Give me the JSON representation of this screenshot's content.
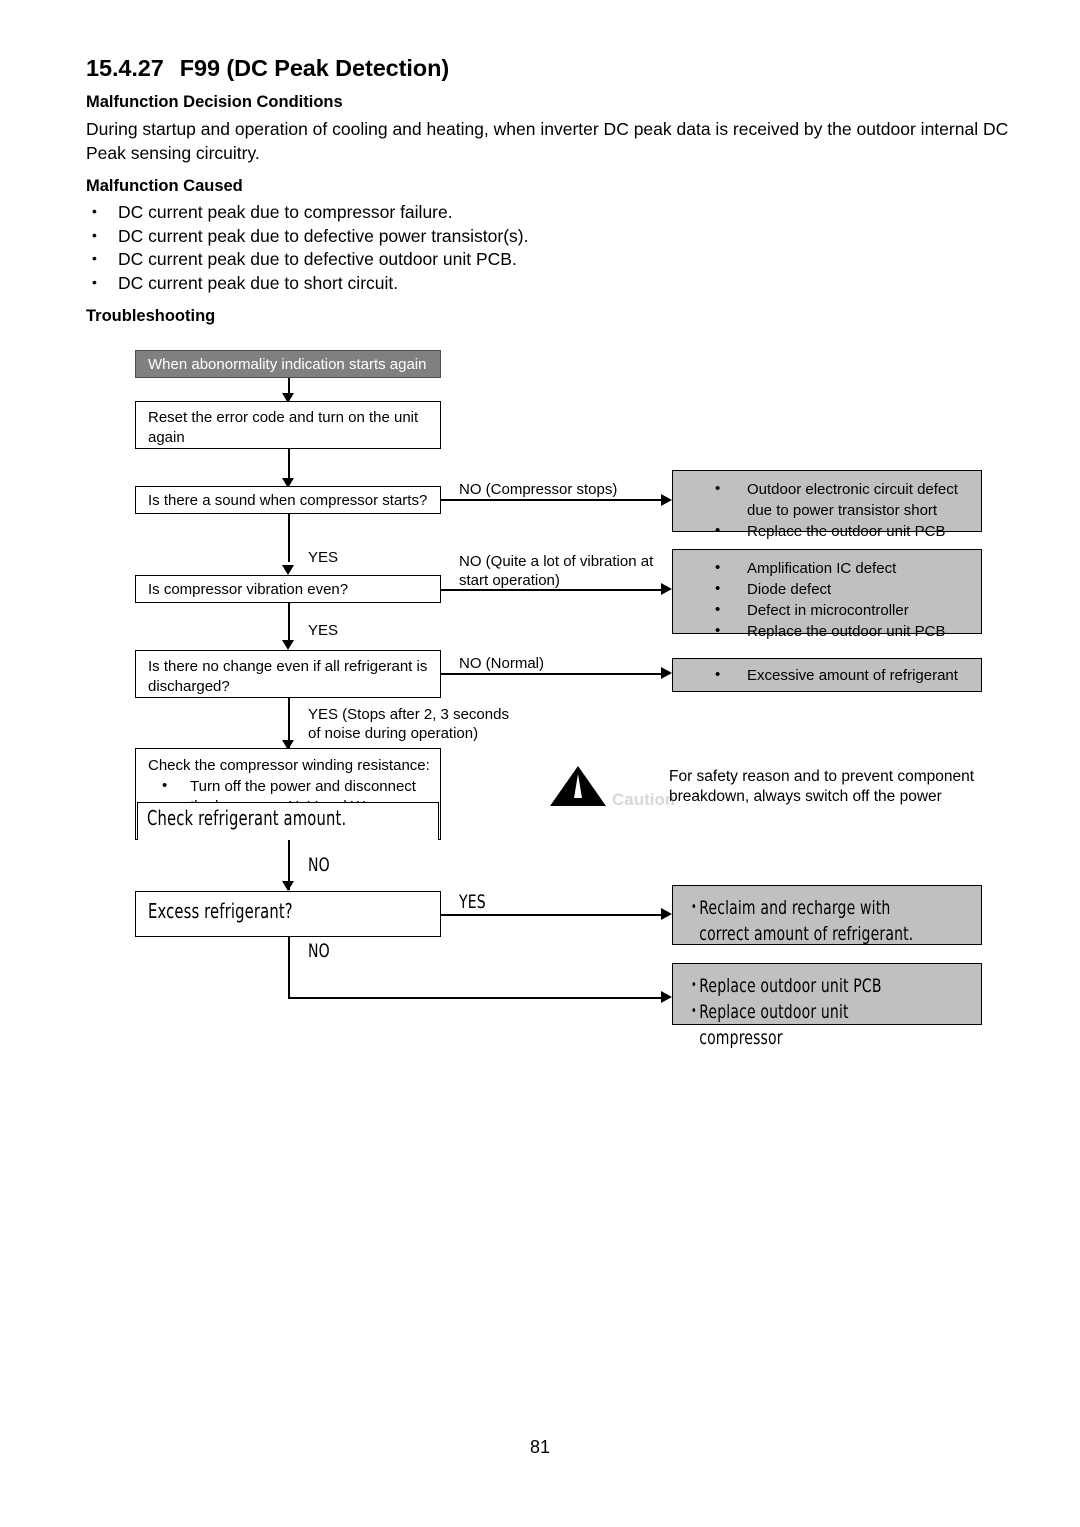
{
  "document": {
    "section_number": "15.4.27",
    "section_title": "F99 (DC Peak Detection)",
    "page_number": "81"
  },
  "malfunction_decision": {
    "heading": "Malfunction Decision Conditions",
    "body": "During startup and operation of cooling and heating, when inverter DC peak data is received by the outdoor internal DC Peak sensing circuitry."
  },
  "malfunction_caused": {
    "heading": "Malfunction Caused",
    "items": [
      "DC current peak due to compressor failure.",
      "DC current peak due to defective power transistor(s).",
      "DC current peak due to defective outdoor unit PCB.",
      "DC current peak due to short circuit."
    ]
  },
  "troubleshooting": {
    "heading": "Troubleshooting",
    "nodes": {
      "start": "When abonormality indication starts again",
      "reset": "Reset the error code and turn on the unit again",
      "sound": "Is there a sound when compressor starts?",
      "vibration": "Is compressor vibration even?",
      "refrigerant_discharged": "Is there no change even if all refrigerant is discharged?",
      "winding_title": "Check the compressor winding resistance:",
      "winding_bullet": "Turn off the power and disconnect the harnesses U. V and W",
      "winding_overlay": "Check refrigerant amount.",
      "excess": "Excess refrigerant?"
    },
    "edges": {
      "no_compressor_stops": "NO (Compressor stops)",
      "yes_1": "YES",
      "no_vibration": "NO (Quite a lot of vibration at\nstart operation)",
      "yes_2": "YES",
      "no_normal": "NO (Normal)",
      "yes_stops": "YES (Stops after 2, 3 seconds\nof noise during operation)",
      "no_overlay_1": "NO",
      "yes_overlay": "YES",
      "no_overlay_2": "NO"
    },
    "results": {
      "r1": [
        "Outdoor electronic circuit defect due to power transistor short",
        "Replace the outdoor unit PCB"
      ],
      "r2": [
        "Amplification IC defect",
        "Diode defect",
        "Defect in microcontroller",
        "Replace the outdoor unit PCB"
      ],
      "r3": [
        "Excessive amount of refrigerant"
      ],
      "r4": [
        "Reclaim and recharge with correct amount of refrigerant."
      ],
      "r5": [
        "Replace outdoor unit PCB",
        "Replace outdoor unit compressor"
      ]
    },
    "caution": {
      "word": "Caution",
      "note": "For safety reason and to prevent component breakdown, always switch off the power"
    }
  },
  "colors": {
    "start_box_fill": "#808080",
    "result_box_fill": "#c0c0c0",
    "line": "#000000",
    "page_bg": "#ffffff"
  }
}
